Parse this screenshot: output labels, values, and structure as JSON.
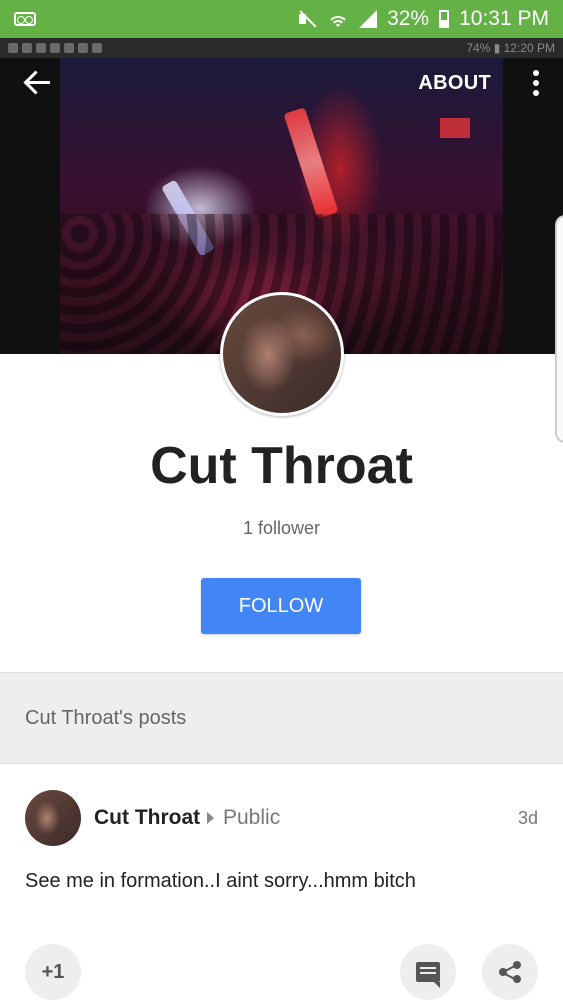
{
  "status_bar": {
    "battery": "32%",
    "time": "10:31 PM",
    "sub_status": "74% ▮ 12:20 PM",
    "accent": "#64b246"
  },
  "nav": {
    "about_label": "ABOUT"
  },
  "profile": {
    "name": "Cut Throat",
    "followers": "1 follower",
    "follow_label": "FOLLOW",
    "follow_color": "#4285f4"
  },
  "posts_section": {
    "title": "Cut Throat's posts"
  },
  "post": {
    "author": "Cut Throat",
    "visibility": "Public",
    "time": "3d",
    "text": "See me in formation..I aint sorry...hmm bitch",
    "plus_one_label": "+1"
  },
  "icons": [
    "voicemail-icon",
    "mute-icon",
    "wifi-icon",
    "signal-icon",
    "battery-icon",
    "back-arrow-icon",
    "more-vert-icon",
    "comment-icon",
    "share-icon"
  ]
}
